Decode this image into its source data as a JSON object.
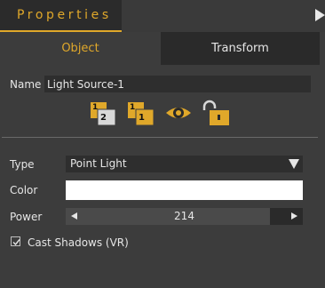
{
  "panel": {
    "title": "Properties",
    "tabs": {
      "object": "Object",
      "transform": "Transform"
    }
  },
  "object": {
    "name_label": "Name",
    "name_value": "Light Source-1",
    "toolbar_icons": [
      "copy-to-layer-icon",
      "layer-one-icon",
      "visibility-eye-icon",
      "unlock-icon"
    ]
  },
  "properties": {
    "type_label": "Type",
    "type_value": "Point Light",
    "color_label": "Color",
    "color_value": "#ffffff",
    "power_label": "Power",
    "power_value": "214",
    "power_fill_fraction": 0.86,
    "cast_shadows_label": "Cast Shadows (VR)",
    "cast_shadows_checked": true
  },
  "colors": {
    "accent": "#e0a82a",
    "background": "#3c3c3c",
    "field": "#2e2e2e"
  }
}
